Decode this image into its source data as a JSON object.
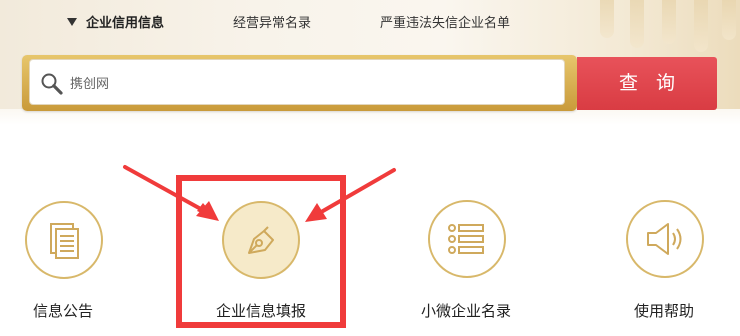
{
  "nav": {
    "tabs": [
      {
        "label": "企业信用信息",
        "active": true
      },
      {
        "label": "经营异常名录",
        "active": false
      },
      {
        "label": "严重违法失信企业名单",
        "active": false
      }
    ]
  },
  "search": {
    "value": "携创网",
    "button_label": "查询"
  },
  "services": [
    {
      "label": "信息公告",
      "icon": "document-icon"
    },
    {
      "label": "企业信息填报",
      "icon": "pen-nib-icon"
    },
    {
      "label": "小微企业名录",
      "icon": "list-icon"
    },
    {
      "label": "使用帮助",
      "icon": "speaker-icon"
    }
  ],
  "colors": {
    "accent_gold": "#d8b86a",
    "search_button": "#e0474e",
    "highlight_red": "#f03b3b"
  }
}
